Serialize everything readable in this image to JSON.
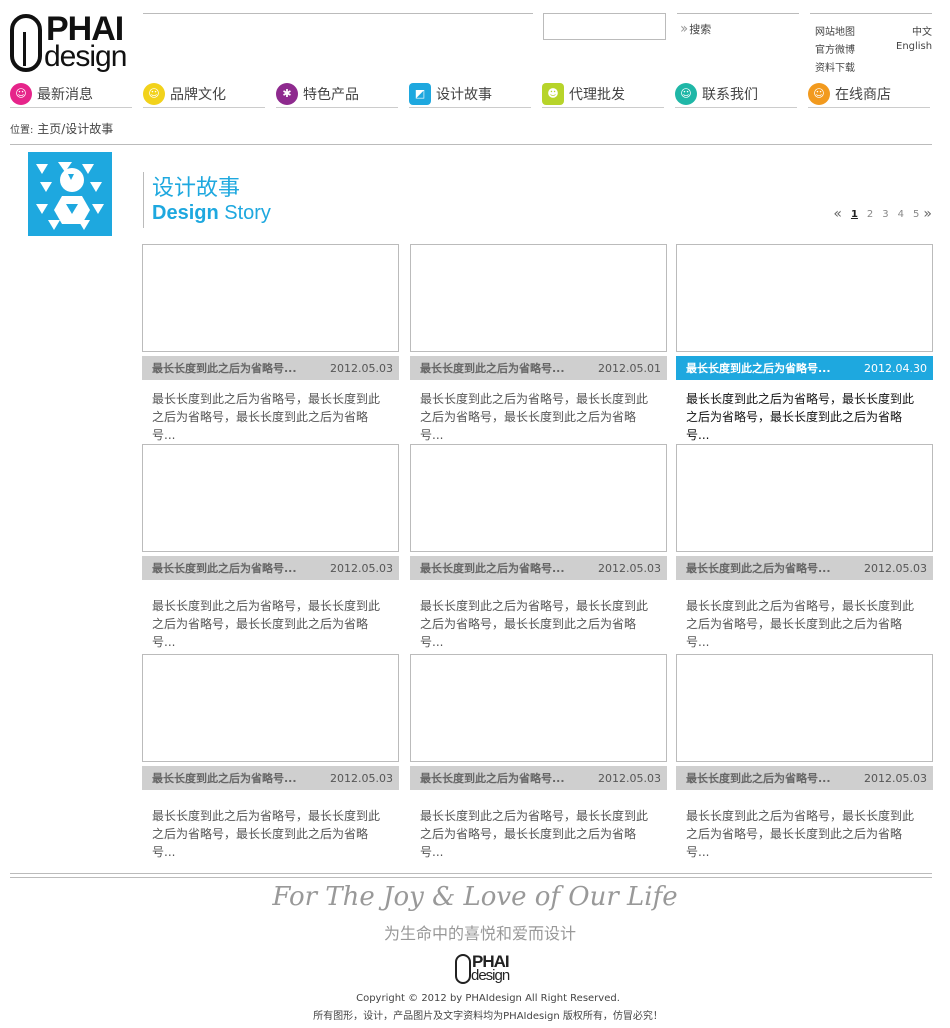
{
  "logo": {
    "line1": "PHAI",
    "line2": "design"
  },
  "search": {
    "placeholder": "",
    "button_label": "搜索"
  },
  "utility_links": {
    "sitemap": "网站地图",
    "weibo": "官方微博",
    "downloads": "资料下载",
    "chinese": "中文",
    "english": "English"
  },
  "nav": {
    "items": [
      {
        "label": "最新消息",
        "icon": "smile-face-icon",
        "color": "#e6248a"
      },
      {
        "label": "品牌文化",
        "icon": "yellow-face-icon",
        "color": "#f2d21b"
      },
      {
        "label": "特色产品",
        "icon": "purple-star-face-icon",
        "color": "#8e2a8e"
      },
      {
        "label": "设计故事",
        "icon": "blue-square-icon",
        "color": "#1ea8df"
      },
      {
        "label": "代理批发",
        "icon": "green-square-face-icon",
        "color": "#b7d42a"
      },
      {
        "label": "联系我们",
        "icon": "teal-face-icon",
        "color": "#1fb7a7"
      },
      {
        "label": "在线商店",
        "icon": "orange-face-icon",
        "color": "#f29a1e"
      }
    ]
  },
  "breadcrumb": {
    "prefix": "位置:",
    "path": "主页/设计故事"
  },
  "section": {
    "title_cn": "设计故事",
    "title_en_bold": "Design",
    "title_en_light": "Story"
  },
  "pagination": {
    "pages": [
      "1",
      "2",
      "3",
      "4",
      "5"
    ],
    "current": "1"
  },
  "cards": [
    {
      "title": "最长长度到此之后为省略号...",
      "date": "2012.05.03",
      "desc": "最长长度到此之后为省略号，最长长度到此之后为省略号，最长长度到此之后为省略号..."
    },
    {
      "title": "最长长度到此之后为省略号...",
      "date": "2012.05.01",
      "desc": "最长长度到此之后为省略号，最长长度到此之后为省略号，最长长度到此之后为省略号..."
    },
    {
      "title": "最长长度到此之后为省略号...",
      "date": "2012.04.30",
      "desc": "最长长度到此之后为省略号，最长长度到此之后为省略号，最长长度到此之后为省略号..."
    },
    {
      "title": "最长长度到此之后为省略号...",
      "date": "2012.05.03",
      "desc": "最长长度到此之后为省略号，最长长度到此之后为省略号，最长长度到此之后为省略号..."
    },
    {
      "title": "最长长度到此之后为省略号...",
      "date": "2012.05.03",
      "desc": "最长长度到此之后为省略号，最长长度到此之后为省略号，最长长度到此之后为省略号..."
    },
    {
      "title": "最长长度到此之后为省略号...",
      "date": "2012.05.03",
      "desc": "最长长度到此之后为省略号，最长长度到此之后为省略号，最长长度到此之后为省略号..."
    },
    {
      "title": "最长长度到此之后为省略号...",
      "date": "2012.05.03",
      "desc": "最长长度到此之后为省略号，最长长度到此之后为省略号，最长长度到此之后为省略号..."
    },
    {
      "title": "最长长度到此之后为省略号...",
      "date": "2012.05.03",
      "desc": "最长长度到此之后为省略号，最长长度到此之后为省略号，最长长度到此之后为省略号..."
    },
    {
      "title": "最长长度到此之后为省略号...",
      "date": "2012.05.03",
      "desc": "最长长度到此之后为省略号，最长长度到此之后为省略号，最长长度到此之后为省略号..."
    }
  ],
  "footer": {
    "slogan_en": "For The Joy & Love of Our Life",
    "slogan_cn": "为生命中的喜悦和爱而设计",
    "logo_line1": "PHAI",
    "logo_line2": "design",
    "copyright": "Copyright © 2012 by PHAIdesign All Right Reserved.",
    "rights": "所有图形，设计，产品图片及文字资料均为PHAIdesign  版权所有，仿冒必究！"
  },
  "colors": {
    "accent": "#1ea8df",
    "bar_gray": "#cfcfcf"
  }
}
